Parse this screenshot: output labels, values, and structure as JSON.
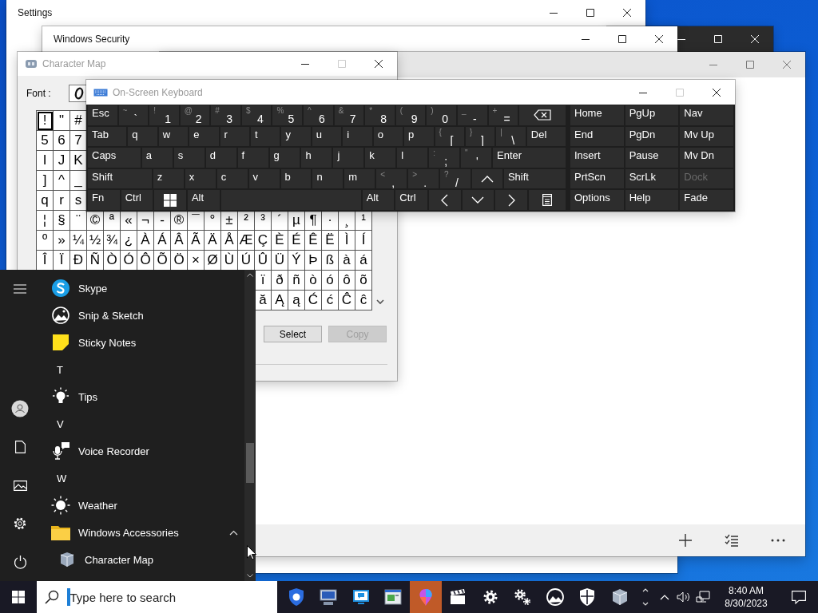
{
  "settings_window": {
    "title": "Settings"
  },
  "security_window": {
    "title": "Windows Security"
  },
  "character_map": {
    "title": "Character Map",
    "font_label": "Font :",
    "grid": [
      [
        {
          "char": "!",
          "selected": true
        },
        {
          "char": "\"",
          "selected": false
        },
        {
          "char": "#",
          "selected": false
        }
      ],
      [
        {
          "char": "5",
          "selected": false
        },
        {
          "char": "6",
          "selected": false
        },
        {
          "char": "7",
          "selected": false
        }
      ],
      [
        {
          "char": "I",
          "selected": false
        },
        {
          "char": "J",
          "selected": false
        },
        {
          "char": "K",
          "selected": false
        }
      ],
      [
        {
          "char": "]",
          "selected": false
        },
        {
          "char": "^",
          "selected": false
        },
        {
          "char": "_",
          "selected": false
        }
      ],
      [
        {
          "char": "q",
          "selected": false
        },
        {
          "char": "r",
          "selected": false
        },
        {
          "char": "s",
          "selected": false
        }
      ],
      [
        {
          "char": "¦",
          "selected": false
        },
        {
          "char": "§",
          "selected": false
        },
        {
          "char": "¨",
          "selected": false
        },
        {
          "char": "©",
          "selected": false
        },
        {
          "char": "ª",
          "selected": false
        },
        {
          "char": "«",
          "selected": false
        },
        {
          "char": "¬",
          "selected": false
        },
        {
          "char": "-",
          "selected": false
        },
        {
          "char": "®",
          "selected": false
        },
        {
          "char": "¯",
          "selected": false
        },
        {
          "char": "°",
          "selected": false
        },
        {
          "char": "±",
          "selected": false
        },
        {
          "char": "²",
          "selected": false
        },
        {
          "char": "³",
          "selected": false
        },
        {
          "char": "´",
          "selected": false
        },
        {
          "char": "µ",
          "selected": false
        },
        {
          "char": "¶",
          "selected": false
        },
        {
          "char": "·",
          "selected": false
        },
        {
          "char": "¸",
          "selected": false
        },
        {
          "char": "¹",
          "selected": false
        }
      ],
      [
        {
          "char": "º",
          "selected": false
        },
        {
          "char": "»",
          "selected": false
        },
        {
          "char": "¼",
          "selected": false
        },
        {
          "char": "½",
          "selected": false
        },
        {
          "char": "¾",
          "selected": false
        },
        {
          "char": "¿",
          "selected": false
        },
        {
          "char": "À",
          "selected": false
        },
        {
          "char": "Á",
          "selected": false
        },
        {
          "char": "Â",
          "selected": false
        },
        {
          "char": "Ã",
          "selected": false
        },
        {
          "char": "Ä",
          "selected": false
        },
        {
          "char": "Å",
          "selected": false
        },
        {
          "char": "Æ",
          "selected": false
        },
        {
          "char": "Ç",
          "selected": false
        },
        {
          "char": "È",
          "selected": false
        },
        {
          "char": "É",
          "selected": false
        },
        {
          "char": "Ê",
          "selected": false
        },
        {
          "char": "Ë",
          "selected": false
        },
        {
          "char": "Ì",
          "selected": false
        },
        {
          "char": "Í",
          "selected": false
        }
      ],
      [
        {
          "char": "Î",
          "selected": false
        },
        {
          "char": "Ï",
          "selected": false
        },
        {
          "char": "Ð",
          "selected": false
        },
        {
          "char": "Ñ",
          "selected": false
        },
        {
          "char": "Ò",
          "selected": false
        },
        {
          "char": "Ó",
          "selected": false
        },
        {
          "char": "Ô",
          "selected": false
        },
        {
          "char": "Õ",
          "selected": false
        },
        {
          "char": "Ö",
          "selected": false
        },
        {
          "char": "×",
          "selected": false
        },
        {
          "char": "Ø",
          "selected": false
        },
        {
          "char": "Ù",
          "selected": false
        },
        {
          "char": "Ú",
          "selected": false
        },
        {
          "char": "Û",
          "selected": false
        },
        {
          "char": "Ü",
          "selected": false
        },
        {
          "char": "Ý",
          "selected": false
        },
        {
          "char": "Þ",
          "selected": false
        },
        {
          "char": "ß",
          "selected": false
        },
        {
          "char": "à",
          "selected": false
        },
        {
          "char": "á",
          "selected": false
        }
      ],
      [
        {
          "char": "ï",
          "selected": false
        },
        {
          "char": "ð",
          "selected": false
        },
        {
          "char": "ñ",
          "selected": false
        },
        {
          "char": "ò",
          "selected": false
        },
        {
          "char": "ó",
          "selected": false
        },
        {
          "char": "ô",
          "selected": false
        },
        {
          "char": "õ",
          "selected": false
        }
      ],
      [
        {
          "char": "ă",
          "selected": false
        },
        {
          "char": "Ą",
          "selected": false
        },
        {
          "char": "ą",
          "selected": false
        },
        {
          "char": "Ć",
          "selected": false
        },
        {
          "char": "ć",
          "selected": false
        },
        {
          "char": "Ĉ",
          "selected": false
        },
        {
          "char": "ĉ",
          "selected": false
        }
      ]
    ],
    "buttons": [
      {
        "label": "Select",
        "disabled": false
      },
      {
        "label": "Copy",
        "disabled": true
      }
    ]
  },
  "keyboard": {
    "title": "On-Screen Keyboard",
    "key_rows": [
      {
        "keys": [
          {
            "kind": "text",
            "label": "Esc"
          },
          {
            "kind": "text",
            "label": "`",
            "shift": "~"
          },
          {
            "kind": "text",
            "label": "1",
            "shift": "!"
          },
          {
            "kind": "text",
            "label": "2",
            "shift": "@"
          },
          {
            "kind": "text",
            "label": "3",
            "shift": "#"
          },
          {
            "kind": "text",
            "label": "4",
            "shift": "$"
          },
          {
            "kind": "text",
            "label": "5",
            "shift": "%"
          },
          {
            "kind": "text",
            "label": "6",
            "shift": "^"
          },
          {
            "kind": "text",
            "label": "7",
            "shift": "&"
          },
          {
            "kind": "text",
            "label": "8",
            "shift": "*"
          },
          {
            "kind": "text",
            "label": "9",
            "shift": "("
          },
          {
            "kind": "text",
            "label": "0",
            "shift": ")"
          },
          {
            "kind": "text",
            "label": "-",
            "shift": "_"
          },
          {
            "kind": "text",
            "label": "=",
            "shift": "+"
          },
          {
            "kind": "backspace"
          }
        ]
      },
      {
        "keys": [
          {
            "kind": "text",
            "label": "Tab"
          },
          {
            "kind": "text",
            "label": "q"
          },
          {
            "kind": "text",
            "label": "w"
          },
          {
            "kind": "text",
            "label": "e"
          },
          {
            "kind": "text",
            "label": "r"
          },
          {
            "kind": "text",
            "label": "t"
          },
          {
            "kind": "text",
            "label": "y"
          },
          {
            "kind": "text",
            "label": "u"
          },
          {
            "kind": "text",
            "label": "i"
          },
          {
            "kind": "text",
            "label": "o"
          },
          {
            "kind": "text",
            "label": "p"
          },
          {
            "kind": "text",
            "label": "[",
            "shift": "{"
          },
          {
            "kind": "text",
            "label": "]",
            "shift": "}"
          },
          {
            "kind": "text",
            "label": "\\",
            "shift": "|"
          },
          {
            "kind": "text",
            "label": "Del"
          }
        ]
      },
      {
        "keys": [
          {
            "kind": "text",
            "label": "Caps"
          },
          {
            "kind": "text",
            "label": "a"
          },
          {
            "kind": "text",
            "label": "s"
          },
          {
            "kind": "text",
            "label": "d"
          },
          {
            "kind": "text",
            "label": "f"
          },
          {
            "kind": "text",
            "label": "g"
          },
          {
            "kind": "text",
            "label": "h"
          },
          {
            "kind": "text",
            "label": "j"
          },
          {
            "kind": "text",
            "label": "k"
          },
          {
            "kind": "text",
            "label": "l"
          },
          {
            "kind": "text",
            "label": ";",
            "shift": ":"
          },
          {
            "kind": "text",
            "label": "'",
            "shift": "\""
          },
          {
            "kind": "text",
            "label": "Enter"
          }
        ]
      },
      {
        "keys": [
          {
            "kind": "text",
            "label": "Shift"
          },
          {
            "kind": "text",
            "label": "z"
          },
          {
            "kind": "text",
            "label": "x"
          },
          {
            "kind": "text",
            "label": "c"
          },
          {
            "kind": "text",
            "label": "v"
          },
          {
            "kind": "text",
            "label": "b"
          },
          {
            "kind": "text",
            "label": "n"
          },
          {
            "kind": "text",
            "label": "m"
          },
          {
            "kind": "text",
            "label": ",",
            "shift": "<"
          },
          {
            "kind": "text",
            "label": ".",
            "shift": ">"
          },
          {
            "kind": "text",
            "label": "/",
            "shift": "?"
          },
          {
            "kind": "up"
          },
          {
            "kind": "text",
            "label": "Shift"
          }
        ]
      },
      {
        "keys": [
          {
            "kind": "text",
            "label": "Fn"
          },
          {
            "kind": "text",
            "label": "Ctrl"
          },
          {
            "kind": "windows"
          },
          {
            "kind": "text",
            "label": "Alt"
          },
          {
            "kind": "space"
          },
          {
            "kind": "text",
            "label": "Alt"
          },
          {
            "kind": "text",
            "label": "Ctrl"
          },
          {
            "kind": "left"
          },
          {
            "kind": "down"
          },
          {
            "kind": "right"
          },
          {
            "kind": "menu"
          }
        ]
      }
    ],
    "nav_keys": [
      {
        "label": "Home",
        "disabled": false
      },
      {
        "label": "PgUp",
        "disabled": false
      },
      {
        "label": "Nav",
        "disabled": false
      },
      {
        "label": "End",
        "disabled": false
      },
      {
        "label": "PgDn",
        "disabled": false
      },
      {
        "label": "Mv Up",
        "disabled": false
      },
      {
        "label": "Insert",
        "disabled": false
      },
      {
        "label": "Pause",
        "disabled": false
      },
      {
        "label": "Mv Dn",
        "disabled": false
      },
      {
        "label": "PrtScn",
        "disabled": false
      },
      {
        "label": "ScrLk",
        "disabled": false
      },
      {
        "label": "Dock",
        "disabled": true
      },
      {
        "label": "Options",
        "disabled": false
      },
      {
        "label": "Help",
        "disabled": false
      },
      {
        "label": "Fade",
        "disabled": false
      }
    ]
  },
  "start_menu": {
    "items": [
      {
        "kind": "app",
        "label": "Skype"
      },
      {
        "kind": "app",
        "label": "Snip & Sketch"
      },
      {
        "kind": "app",
        "label": "Sticky Notes"
      },
      {
        "kind": "header",
        "label": "T"
      },
      {
        "kind": "app",
        "label": "Tips"
      },
      {
        "kind": "header",
        "label": "V"
      },
      {
        "kind": "app",
        "label": "Voice Recorder"
      },
      {
        "kind": "header",
        "label": "W"
      },
      {
        "kind": "app",
        "label": "Weather"
      },
      {
        "kind": "folder",
        "label": "Windows Accessories",
        "expanded": true
      },
      {
        "kind": "subapp",
        "label": "Character Map"
      }
    ]
  },
  "taskbar": {
    "search": {
      "placeholder": "Type here to search"
    },
    "apps": [
      {
        "active": false
      },
      {
        "active": false
      },
      {
        "active": false
      },
      {
        "active": false
      },
      {
        "active": true
      },
      {
        "active": false
      },
      {
        "active": false
      },
      {
        "active": false
      },
      {
        "active": false
      },
      {
        "active": false
      },
      {
        "active": false
      }
    ],
    "clock": {
      "time": "8:40 AM",
      "date": "8/30/2023"
    }
  }
}
